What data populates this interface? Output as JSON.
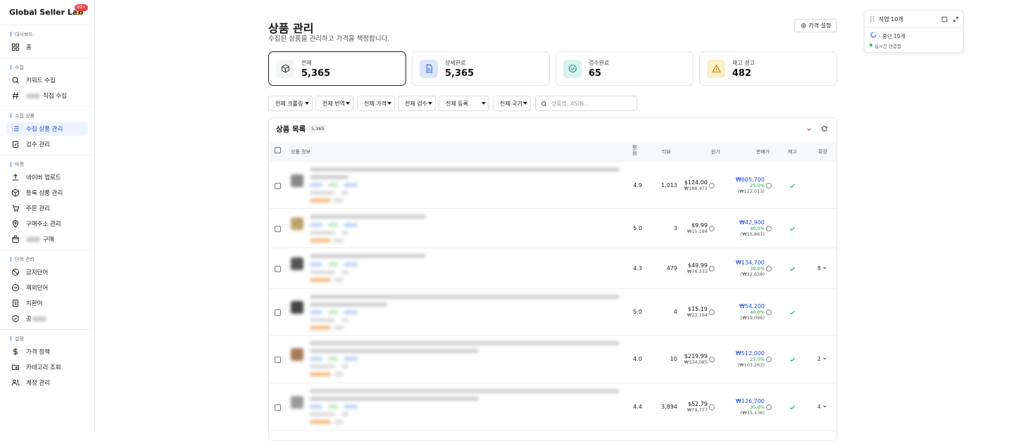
{
  "brand": {
    "name": "Global Seller Lab",
    "badge": "99+"
  },
  "sidebar": {
    "sections": [
      {
        "title": "대시보드",
        "items": [
          {
            "label": "홈",
            "icon": "grid-icon"
          }
        ]
      },
      {
        "title": "수집",
        "items": [
          {
            "label": "키워드 수집",
            "icon": "search-icon"
          },
          {
            "label": "직접 수집",
            "icon": "hash-icon",
            "blurred_prefix": true
          }
        ]
      },
      {
        "title": "수집 상품",
        "items": [
          {
            "label": "수집 상품 관리",
            "icon": "list-icon",
            "active": true
          },
          {
            "label": "검수 관리",
            "icon": "clipboard-check-icon"
          }
        ]
      },
      {
        "title": "마켓",
        "items": [
          {
            "label": "네이버 업로드",
            "icon": "upload-icon"
          },
          {
            "label": "등록 상품 관리",
            "icon": "box-icon"
          },
          {
            "label": "주문 관리",
            "icon": "cart-icon"
          },
          {
            "label": "구매주소 관리",
            "icon": "map-pin-icon"
          },
          {
            "label": "구매",
            "icon": "bag-icon",
            "blurred_prefix": true
          }
        ]
      },
      {
        "title": "단어 관리",
        "items": [
          {
            "label": "금지단어",
            "icon": "ban-icon"
          },
          {
            "label": "제외단어",
            "icon": "minus-circle-icon"
          },
          {
            "label": "치환어",
            "icon": "swap-icon"
          },
          {
            "label": "공",
            "icon": "shield-icon",
            "blurred_suffix": true
          }
        ]
      },
      {
        "title": "설정",
        "items": [
          {
            "label": "가격 정책",
            "icon": "dollar-icon"
          },
          {
            "label": "카테고리 조회",
            "icon": "folder-icon"
          },
          {
            "label": "계정 관리",
            "icon": "users-icon"
          }
        ]
      }
    ]
  },
  "page": {
    "title": "상품 관리",
    "subtitle": "수집된 상품을 관리하고 가격을 책정합니다.",
    "price_setting": "가격 설정"
  },
  "stats": [
    {
      "label": "전체",
      "value": "5,365",
      "icon": "cube-icon",
      "color": "#f3f4f6"
    },
    {
      "label": "상세완료",
      "value": "5,365",
      "icon": "doc-icon",
      "color": "#dbe7fb"
    },
    {
      "label": "검수완료",
      "value": "65",
      "icon": "check-circle-icon",
      "color": "#d8f3ef"
    },
    {
      "label": "재고 경고",
      "value": "482",
      "icon": "warning-icon",
      "color": "#fdf0c8"
    }
  ],
  "filters": [
    "전체 크롤링",
    "전체 번역",
    "전체 가격",
    "전체 검수",
    "전체 등록",
    "전체 국가"
  ],
  "search": {
    "placeholder": "상품명, ASIN..."
  },
  "list": {
    "title": "상품 목록",
    "count": "5,365",
    "headers": {
      "info": "상품 정보",
      "rating": "평점",
      "review": "리뷰",
      "cost": "원가",
      "price": "판매가",
      "stock": "재고",
      "expand": "확장"
    },
    "rows": [
      {
        "rating": "4.9",
        "reviews": "1,013",
        "cost_usd": "$124.00",
        "cost_krw": "₩188,471",
        "price": "₩605,700",
        "margin": "25.0%",
        "profit": "(₩122,013)",
        "expand": ""
      },
      {
        "rating": "5.0",
        "reviews": "3",
        "cost_usd": "$9.99",
        "cost_krw": "₩15,184",
        "price": "₩42,900",
        "margin": "40.0%",
        "profit": "(₩15,861)",
        "expand": ""
      },
      {
        "rating": "4.3",
        "reviews": "479",
        "cost_usd": "$49.99",
        "cost_krw": "₩76,333",
        "price": "₩134,700",
        "margin": "30.0%",
        "profit": "(₩32,638)",
        "expand": "8"
      },
      {
        "rating": "5.0",
        "reviews": "4",
        "cost_usd": "$15.19",
        "cost_krw": "₩23,194",
        "price": "₩54,200",
        "margin": "40.0%",
        "profit": "(₩19,096)",
        "expand": ""
      },
      {
        "rating": "4.0",
        "reviews": "10",
        "cost_usd": "$219.99",
        "cost_krw": "₩334,085",
        "price": "₩512,000",
        "margin": "25.0%",
        "profit": "(₩103,263)",
        "expand": "2"
      },
      {
        "rating": "4.4",
        "reviews": "3,894",
        "cost_usd": "$52.79",
        "cost_krw": "₩79,777",
        "price": "₩126,700",
        "margin": "35.0%",
        "profit": "(₩35,136)",
        "expand": "4"
      }
    ]
  },
  "job": {
    "title": "작업 10개",
    "status": "- 중단 10개",
    "live": "실시간 연결됨"
  }
}
